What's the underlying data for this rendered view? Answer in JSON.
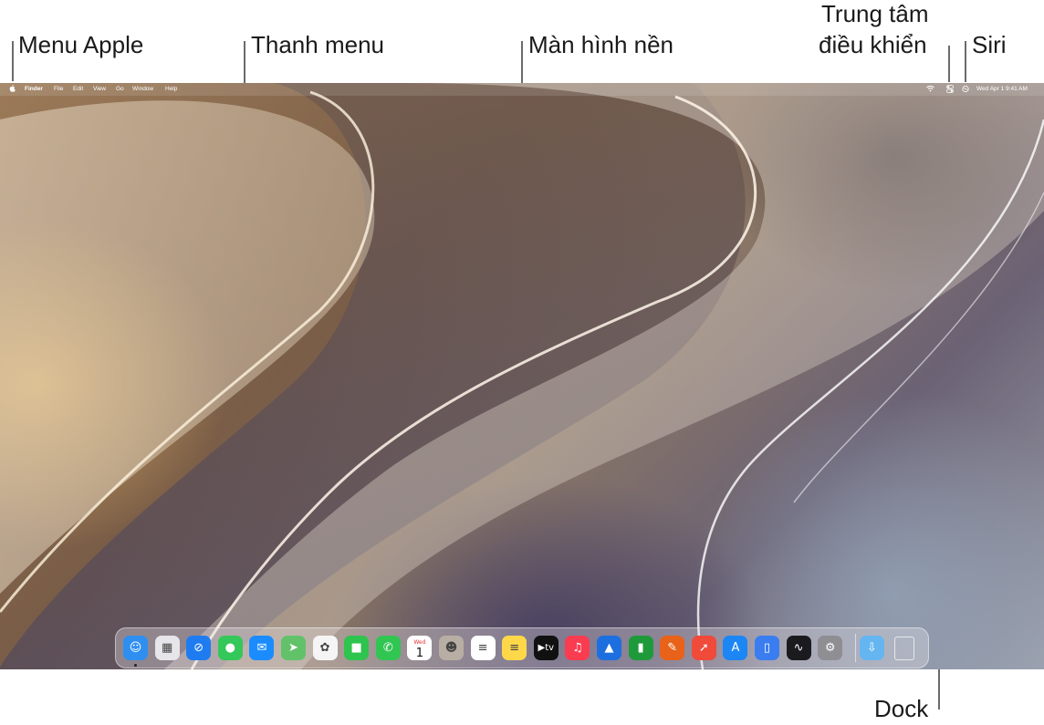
{
  "callouts": {
    "apple_menu": "Menu Apple",
    "menu_bar": "Thanh menu",
    "desktop": "Màn hình nền",
    "control_center_line1": "Trung tâm",
    "control_center_line2": "điều khiển",
    "siri": "Siri",
    "dock": "Dock"
  },
  "menubar": {
    "apple": "",
    "items": [
      "Finder",
      "File",
      "Edit",
      "View",
      "Go",
      "Window",
      "Help"
    ],
    "datetime": "Wed Apr 1  9:41 AM"
  },
  "dock": {
    "apps": [
      {
        "name": "finder",
        "glyph": "☺",
        "color": "#2f8ff0"
      },
      {
        "name": "launchpad",
        "glyph": "▦",
        "color": "#e6e6ea"
      },
      {
        "name": "safari",
        "glyph": "⊘",
        "color": "#1e7cf0"
      },
      {
        "name": "messages",
        "glyph": "●",
        "color": "#34c759"
      },
      {
        "name": "mail",
        "glyph": "✉",
        "color": "#1a8cff"
      },
      {
        "name": "maps",
        "glyph": "➤",
        "color": "#62c26a"
      },
      {
        "name": "photos",
        "glyph": "✿",
        "color": "#f5f5f5"
      },
      {
        "name": "facetime",
        "glyph": "■",
        "color": "#2ec44d"
      },
      {
        "name": "phone",
        "glyph": "✆",
        "color": "#31c552"
      },
      {
        "name": "calendar",
        "glyph": "1",
        "color": "#ffffff"
      },
      {
        "name": "contacts",
        "glyph": "☻",
        "color": "#b9aea3"
      },
      {
        "name": "reminders",
        "glyph": "≡",
        "color": "#ffffff"
      },
      {
        "name": "notes",
        "glyph": "≡",
        "color": "#ffd84a"
      },
      {
        "name": "tv",
        "glyph": "tv",
        "color": "#111111"
      },
      {
        "name": "music",
        "glyph": "♫",
        "color": "#fa3c51"
      },
      {
        "name": "keynote",
        "glyph": "▲",
        "color": "#1d6fe0"
      },
      {
        "name": "numbers",
        "glyph": "▮",
        "color": "#1f9a3a"
      },
      {
        "name": "pages",
        "glyph": "✎",
        "color": "#e8621a"
      },
      {
        "name": "app-a",
        "glyph": "➚",
        "color": "#f04a3a"
      },
      {
        "name": "app-store",
        "glyph": "A",
        "color": "#1c86f5"
      },
      {
        "name": "iphone-mirroring",
        "glyph": "▯",
        "color": "#3a7df0"
      },
      {
        "name": "stocks",
        "glyph": "∿",
        "color": "#1b1b1f"
      },
      {
        "name": "system-settings",
        "glyph": "⚙",
        "color": "#8e8e93"
      },
      {
        "name": "downloads",
        "glyph": "⇩",
        "color": "#65b6f0"
      },
      {
        "name": "trash",
        "glyph": "🗑",
        "color": "transparent"
      }
    ],
    "calendar_day": "Wed",
    "calendar_date": "1",
    "tv_label": "tv"
  },
  "colors": {
    "menubar_text": "#ffffff",
    "callout_text": "#1a1a1a",
    "leader_line": "#6b6b6b"
  }
}
